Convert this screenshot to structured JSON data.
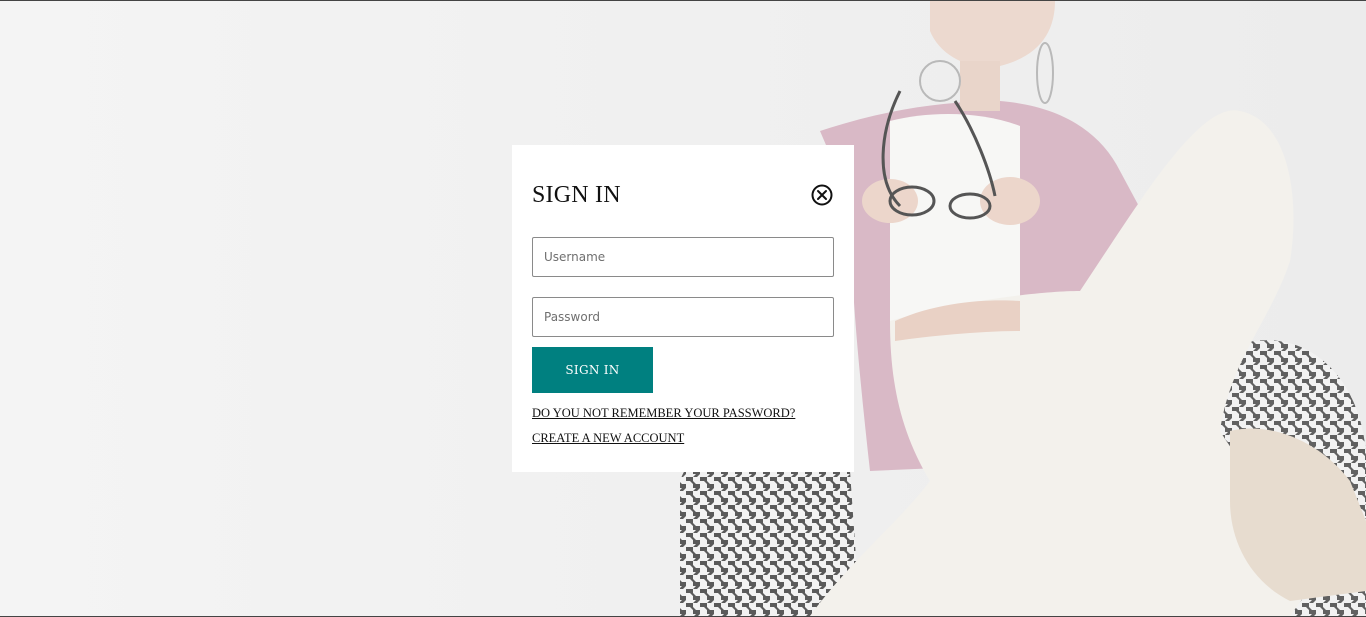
{
  "signin_modal": {
    "title": "SIGN IN",
    "close_icon": "close-circle-x-icon",
    "username": {
      "placeholder": "Username",
      "value": ""
    },
    "password": {
      "placeholder": "Password",
      "value": ""
    },
    "submit_label": "SIGN IN",
    "forgot_password_label": "DO YOU NOT REMEMBER YOUR PASSWORD?",
    "create_account_label": "CREATE A NEW ACCOUNT"
  },
  "colors": {
    "accent": "#008080",
    "background": "#efefef",
    "modal_background": "#ffffff"
  }
}
